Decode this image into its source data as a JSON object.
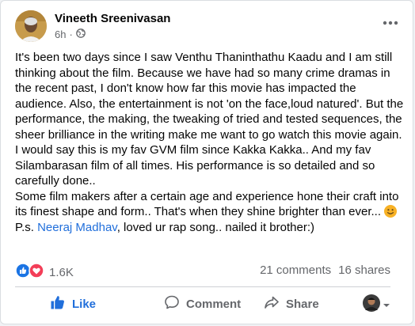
{
  "author": {
    "name": "Vineeth Sreenivasan",
    "time": "6h",
    "separator": "·"
  },
  "icons": {
    "privacy": "globe-icon",
    "more": "more-horizontal-icon",
    "like": "thumbs-up-icon",
    "comment": "comment-icon",
    "share": "share-icon",
    "emoji": "smiling-face-icon"
  },
  "post": {
    "paragraph1": "It's been two days since I saw Venthu Thaninthathu Kaadu and I am still thinking about the film. Because we have had so many crime dramas in the recent past, I don't know how far this movie has impacted the audience. Also, the entertainment is not 'on the face,loud natured'. But the performance, the making, the tweaking of tried and tested sequences, the sheer brilliance in the writing make me want to go watch this movie again. I would say this is my fav GVM film since Kakka Kakka.. And my fav Silambarasan film of all times. His performance is so detailed and so carefully done..",
    "paragraph2": "Some film makers after a certain age and experience hone their craft into its finest shape and form.. That's when they shine brighter than ever...",
    "ps_prefix": "P.s. ",
    "ps_mention": "Neeraj Madhav",
    "ps_suffix": ", loved ur rap song.. nailed it brother:)"
  },
  "stats": {
    "reaction_count": "1.6K",
    "comments": "21 comments",
    "shares": "16 shares"
  },
  "actions": {
    "like": "Like",
    "comment": "Comment",
    "share": "Share"
  },
  "colors": {
    "like_blue": "#216fdb",
    "love_red": "#f33e58",
    "text_gray": "#65676b"
  }
}
